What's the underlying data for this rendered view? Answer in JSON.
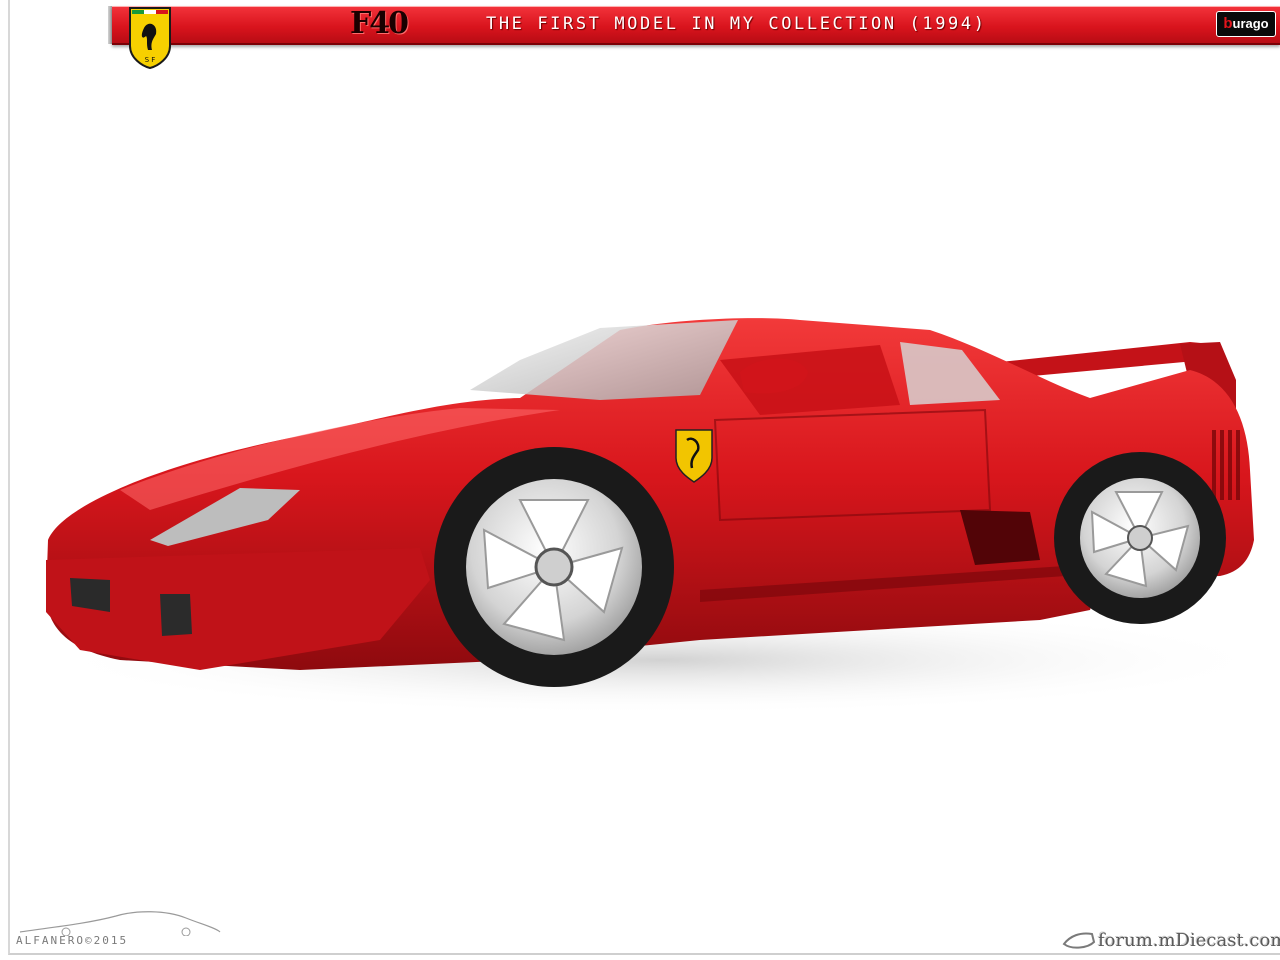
{
  "banner": {
    "model_logo": "F40",
    "title": "THE FIRST MODEL IN MY COLLECTION (1994)",
    "brand_logo": "burago",
    "brand_logo_initial": "b",
    "brand_logo_rest": "urago",
    "shield_icon": "ferrari-prancing-horse-shield",
    "colors": {
      "banner_red": "#d9141d",
      "shield_yellow": "#f7d000"
    }
  },
  "photo": {
    "subject_color": "#d6161c",
    "background": "#ffffff"
  },
  "signature": {
    "text": "ALFANERO©2015"
  },
  "watermark": {
    "text": "forum.mDiecast.com"
  }
}
